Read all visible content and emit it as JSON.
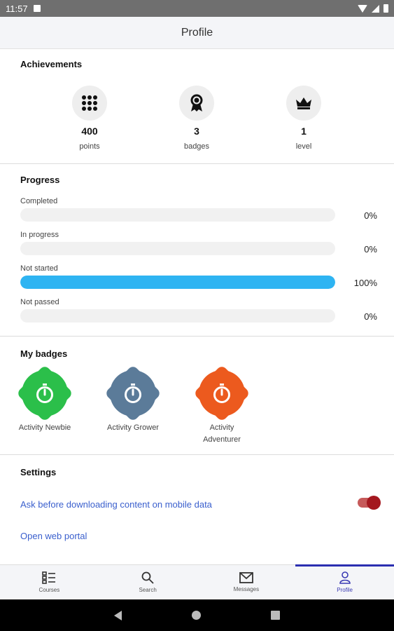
{
  "status_bar": {
    "time": "11:57"
  },
  "app_bar": {
    "title": "Profile"
  },
  "achievements": {
    "title": "Achievements",
    "items": [
      {
        "icon": "grid-icon",
        "value": "400",
        "label": "points"
      },
      {
        "icon": "award-ribbon-icon",
        "value": "3",
        "label": "badges"
      },
      {
        "icon": "crown-icon",
        "value": "1",
        "label": "level"
      }
    ]
  },
  "progress": {
    "title": "Progress",
    "rows": [
      {
        "label": "Completed",
        "percent_text": "0%",
        "percent": 0
      },
      {
        "label": "In progress",
        "percent_text": "0%",
        "percent": 0
      },
      {
        "label": "Not started",
        "percent_text": "100%",
        "percent": 100
      },
      {
        "label": "Not passed",
        "percent_text": "0%",
        "percent": 0
      }
    ],
    "fill_color": "#2eb4f2"
  },
  "badges": {
    "title": "My badges",
    "items": [
      {
        "label": "Activity Newbie",
        "color": "#2bbf4a",
        "icon": "stopwatch-icon"
      },
      {
        "label": "Activity Grower",
        "color": "#5b7b99",
        "icon": "stopwatch-icon"
      },
      {
        "label": "Activity Adventurer",
        "color": "#ec5a1e",
        "icon": "stopwatch-icon"
      }
    ]
  },
  "settings": {
    "title": "Settings",
    "mobile_data_label": "Ask before downloading content on mobile data",
    "mobile_data_enabled": true,
    "web_portal_label": "Open web portal"
  },
  "bottom_nav": {
    "items": [
      {
        "label": "Courses",
        "icon": "courses-icon",
        "active": false
      },
      {
        "label": "Search",
        "icon": "search-icon",
        "active": false
      },
      {
        "label": "Messages",
        "icon": "envelope-icon",
        "active": false
      },
      {
        "label": "Profile",
        "icon": "person-icon",
        "active": true
      }
    ]
  },
  "colors": {
    "accent": "#2b2fb0",
    "link": "#3a5fcd",
    "toggle": "#a4181f"
  }
}
